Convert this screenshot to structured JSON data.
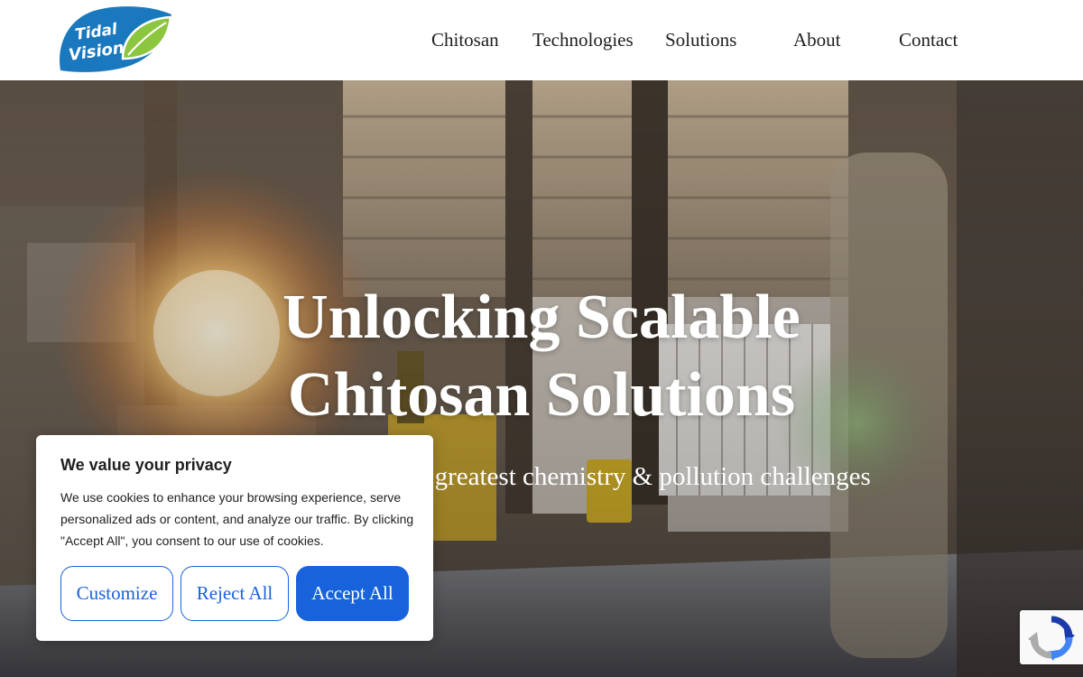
{
  "brand": {
    "logo_line1": "Tidal",
    "logo_line2": "Vision"
  },
  "nav": {
    "items": [
      {
        "label": "Chitosan"
      },
      {
        "label": "Technologies"
      },
      {
        "label": "Solutions"
      },
      {
        "label": "About"
      },
      {
        "label": "Contact"
      }
    ]
  },
  "hero": {
    "title_line1": "Unlocking Scalable",
    "title_line2": "Chitosan Solutions",
    "subtitle": "Solving the world's greatest chemistry & pollution challenges",
    "background": "warehouse-loading-dock-photo"
  },
  "cookie_banner": {
    "title": "We value your privacy",
    "text": "We use cookies to enhance your browsing experience, serve personalized ads or content, and analyze our traffic. By clicking \"Accept All\", you consent to our use of cookies.",
    "customize_label": "Customize",
    "reject_label": "Reject All",
    "accept_label": "Accept All"
  },
  "recaptcha": {
    "icon": "recaptcha-icon"
  },
  "colors": {
    "accent": "#1863dc",
    "logo_blue": "#1a78be",
    "logo_green": "#8cc63f",
    "nav_text": "#1f1f1f"
  }
}
